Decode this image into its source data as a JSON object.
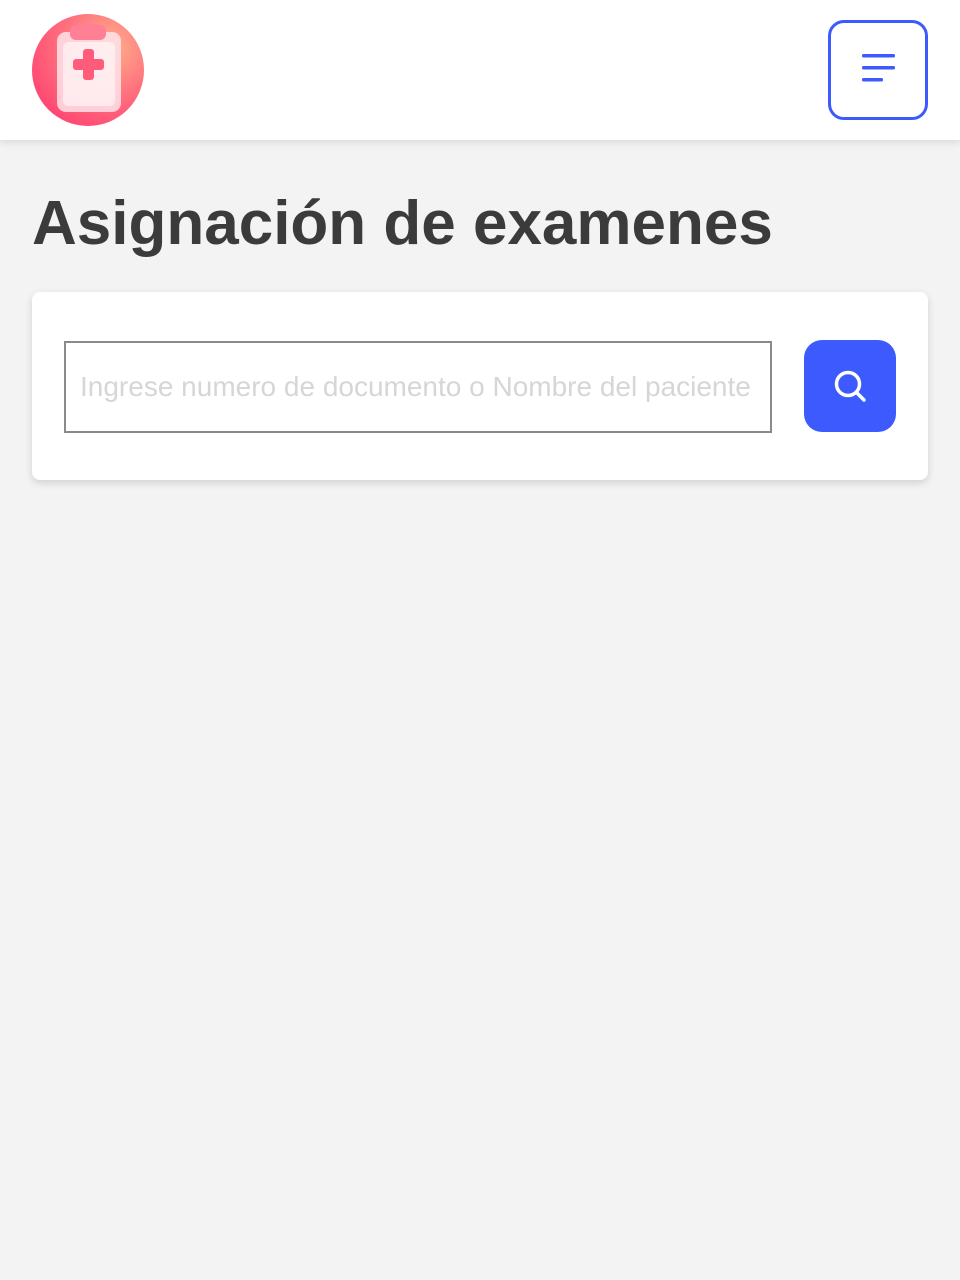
{
  "header": {
    "logo_icon": "clipboard-medical-icon",
    "menu_icon": "menu-lines-icon",
    "accent_color": "#3d5afe"
  },
  "page": {
    "title": "Asignación de examenes"
  },
  "search": {
    "value": "",
    "placeholder": "Ingrese numero de documento o Nombre del paciente",
    "button_icon": "search-icon"
  }
}
